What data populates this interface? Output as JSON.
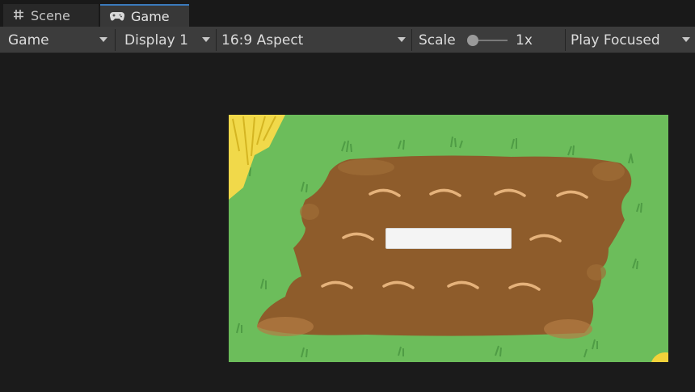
{
  "tabs": [
    {
      "label": "Scene",
      "icon": "grid-icon"
    },
    {
      "label": "Game",
      "icon": "gamepad-icon",
      "active": true
    }
  ],
  "toolbar": {
    "view_mode": "Game",
    "display": "Display 1",
    "aspect": "16:9 Aspect",
    "scale_label": "Scale",
    "scale_value": "1x",
    "scale_level": 0,
    "play_mode": "Play Focused"
  },
  "game": {
    "input_value": ""
  },
  "colors": {
    "grass": "#6cbd5b",
    "soil": "#8e5c2b",
    "tab_accent": "#3a79bb"
  }
}
